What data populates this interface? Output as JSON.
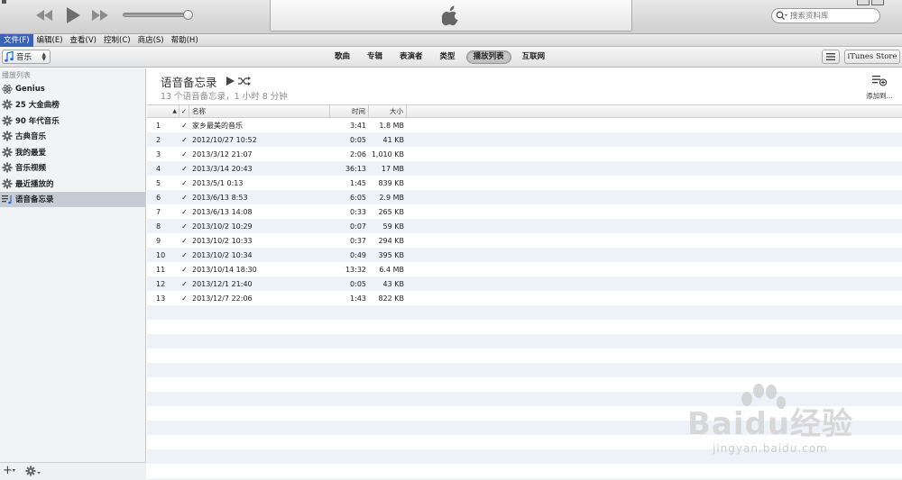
{
  "search": {
    "placeholder": "搜索资料库"
  },
  "menu": {
    "items": [
      {
        "label": "文件(F)",
        "active": true
      },
      {
        "label": "编辑(E)",
        "active": false
      },
      {
        "label": "查看(V)",
        "active": false
      },
      {
        "label": "控制(C)",
        "active": false
      },
      {
        "label": "商店(S)",
        "active": false
      },
      {
        "label": "帮助(H)",
        "active": false
      }
    ]
  },
  "library": {
    "selected": "音乐"
  },
  "nav": {
    "tabs": [
      {
        "label": "歌曲",
        "selected": false
      },
      {
        "label": "专辑",
        "selected": false
      },
      {
        "label": "表演者",
        "selected": false
      },
      {
        "label": "类型",
        "selected": false
      },
      {
        "label": "播放列表",
        "selected": true
      },
      {
        "label": "互联网",
        "selected": false
      }
    ],
    "store_label": "iTunes Store"
  },
  "sidebar": {
    "header": "播放列表",
    "items": [
      {
        "label": "Genius",
        "icon": "genius-atom-icon",
        "selected": false
      },
      {
        "label": "25 大金曲榜",
        "icon": "smart-playlist-gear-icon",
        "selected": false
      },
      {
        "label": "90 年代音乐",
        "icon": "smart-playlist-gear-icon",
        "selected": false
      },
      {
        "label": "古典音乐",
        "icon": "smart-playlist-gear-icon",
        "selected": false
      },
      {
        "label": "我的最爱",
        "icon": "smart-playlist-gear-icon",
        "selected": false
      },
      {
        "label": "音乐视频",
        "icon": "smart-playlist-gear-icon",
        "selected": false
      },
      {
        "label": "最近播放的",
        "icon": "smart-playlist-gear-icon",
        "selected": false
      },
      {
        "label": "语音备忘录",
        "icon": "playlist-icon",
        "selected": true
      }
    ]
  },
  "playlist": {
    "title": "语音备忘录",
    "subtitle": "13 个语音备忘录，1 小时 8 分钟",
    "add_to_label": "添加到..."
  },
  "table": {
    "headers": {
      "check": "✓",
      "name": "名称",
      "time": "时间",
      "size": "大小"
    },
    "rows": [
      {
        "num": "1",
        "checked": "✓",
        "name": "家乡最美的音乐",
        "time": "3:41",
        "size": "1.8 MB"
      },
      {
        "num": "2",
        "checked": "✓",
        "name": "2012/10/27 10:52",
        "time": "0:05",
        "size": "41 KB"
      },
      {
        "num": "3",
        "checked": "✓",
        "name": "2013/3/12 21:07",
        "time": "2:06",
        "size": "1,010 KB"
      },
      {
        "num": "4",
        "checked": "✓",
        "name": "2013/3/14 20:43",
        "time": "36:13",
        "size": "17 MB"
      },
      {
        "num": "5",
        "checked": "✓",
        "name": "2013/5/1 0:13",
        "time": "1:45",
        "size": "839 KB"
      },
      {
        "num": "6",
        "checked": "✓",
        "name": "2013/6/13 8:53",
        "time": "6:05",
        "size": "2.9 MB"
      },
      {
        "num": "7",
        "checked": "✓",
        "name": "2013/6/13 14:08",
        "time": "0:33",
        "size": "265 KB"
      },
      {
        "num": "8",
        "checked": "✓",
        "name": "2013/10/2 10:29",
        "time": "0:07",
        "size": "59 KB"
      },
      {
        "num": "9",
        "checked": "✓",
        "name": "2013/10/2 10:33",
        "time": "0:37",
        "size": "294 KB"
      },
      {
        "num": "10",
        "checked": "✓",
        "name": "2013/10/2 10:34",
        "time": "0:49",
        "size": "395 KB"
      },
      {
        "num": "11",
        "checked": "✓",
        "name": "2013/10/14 18:30",
        "time": "13:32",
        "size": "6.4 MB"
      },
      {
        "num": "12",
        "checked": "✓",
        "name": "2013/12/1 21:40",
        "time": "0:05",
        "size": "43 KB"
      },
      {
        "num": "13",
        "checked": "✓",
        "name": "2013/12/7 22:06",
        "time": "1:43",
        "size": "822 KB"
      }
    ]
  },
  "watermark": {
    "text": "Baidu经验",
    "sub": "jingyan.baidu.com"
  },
  "colors": {
    "menu_active": "#3a63b3",
    "sidebar_selected": "#c6ccd6",
    "row_alt": "#edf2f8"
  }
}
